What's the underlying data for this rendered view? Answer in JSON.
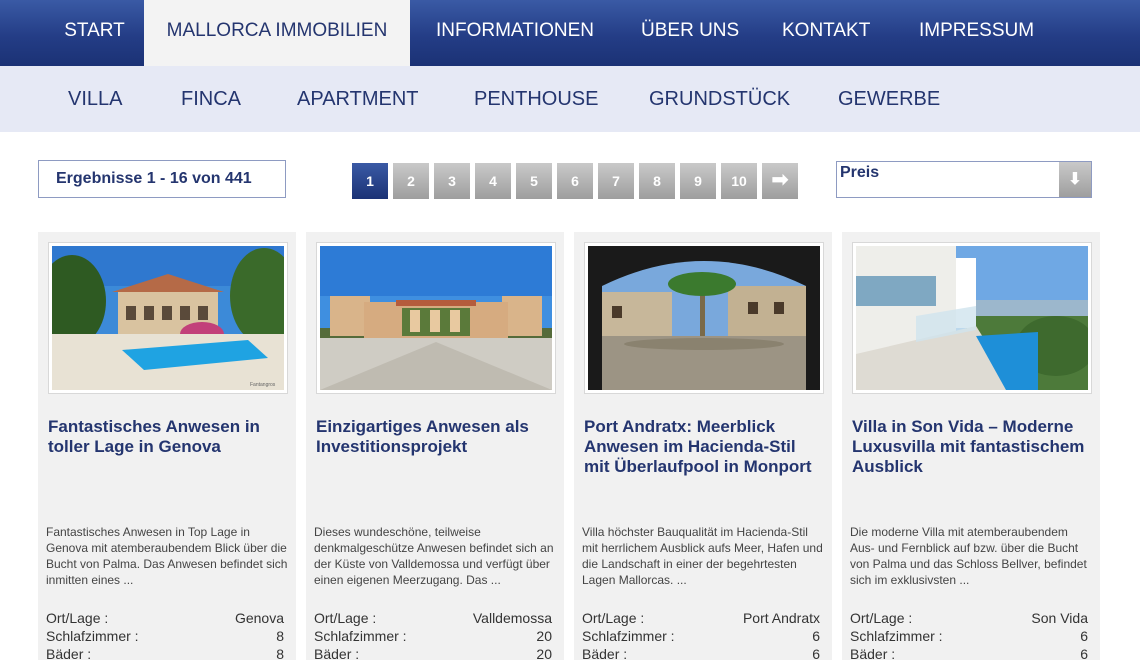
{
  "top_nav": [
    {
      "label": "Start",
      "active": false
    },
    {
      "label": "Mallorca Immobilien",
      "active": true
    },
    {
      "label": "Informationen",
      "active": false
    },
    {
      "label": "Über uns",
      "active": false
    },
    {
      "label": "Kontakt",
      "active": false
    },
    {
      "label": "Impressum",
      "active": false
    }
  ],
  "sub_nav": [
    "VILLA",
    "FINCA",
    "APARTMENT",
    "PENTHOUSE",
    "GRUNDSTÜCK",
    "GEWERBE"
  ],
  "results_text": "Ergebnisse 1 - 16 von 441",
  "pagination": {
    "pages": [
      "1",
      "2",
      "3",
      "4",
      "5",
      "6",
      "7",
      "8",
      "9",
      "10"
    ],
    "current": "1",
    "next_icon": "arrow-right-icon"
  },
  "sort": {
    "label": "Preis",
    "icon": "arrow-down-icon"
  },
  "labels": {
    "location": "Ort/Lage :",
    "bedrooms": "Schlafzimmer :",
    "bathrooms": "Bäder :"
  },
  "listings": [
    {
      "title": "Fantastisches Anwesen in toller Lage in Genova",
      "description": "Fantastisches Anwesen in Top Lage in Genova mit atemberaubendem Blick über die Bucht von Palma. Das Anwesen befindet sich inmitten eines ...",
      "location": "Genova",
      "bedrooms": "8",
      "bathrooms": "8",
      "photo_caption": "Fantangros",
      "image": "villa-with-pool-photo"
    },
    {
      "title": "Einzigartiges Anwesen als Investitionsprojekt",
      "description": "Dieses wundeschöne, teilweise denkmalgeschütze Anwesen befindet sich an der Küste von Valldemossa und verfügt über einen eigenen Meerzugang. Das ...",
      "location": "Valldemossa",
      "bedrooms": "20",
      "bathrooms": "20",
      "image": "historic-manor-photo"
    },
    {
      "title": "Port Andratx: Meerblick Anwesen im Hacienda-Stil mit Überlaufpool in Monport",
      "description": "Villa höchster Bauqualität im Hacienda-Stil mit herrlichem Ausblick aufs Meer, Hafen und die Landschaft in einer der begehrtesten Lagen Mallorcas. ...",
      "location": "Port Andratx",
      "bedrooms": "6",
      "bathrooms": "6",
      "image": "hacienda-courtyard-photo"
    },
    {
      "title": "Villa in Son Vida – Moderne Luxusvilla mit fantastischem Ausblick",
      "description": "Die moderne Villa mit atemberaubendem Aus- und Fernblick auf bzw. über die Bucht von Palma und das Schloss Bellver, befindet sich im exklusivsten ...",
      "location": "Son Vida",
      "bedrooms": "6",
      "bathrooms": "6",
      "image": "modern-villa-infinity-pool-photo"
    }
  ]
}
